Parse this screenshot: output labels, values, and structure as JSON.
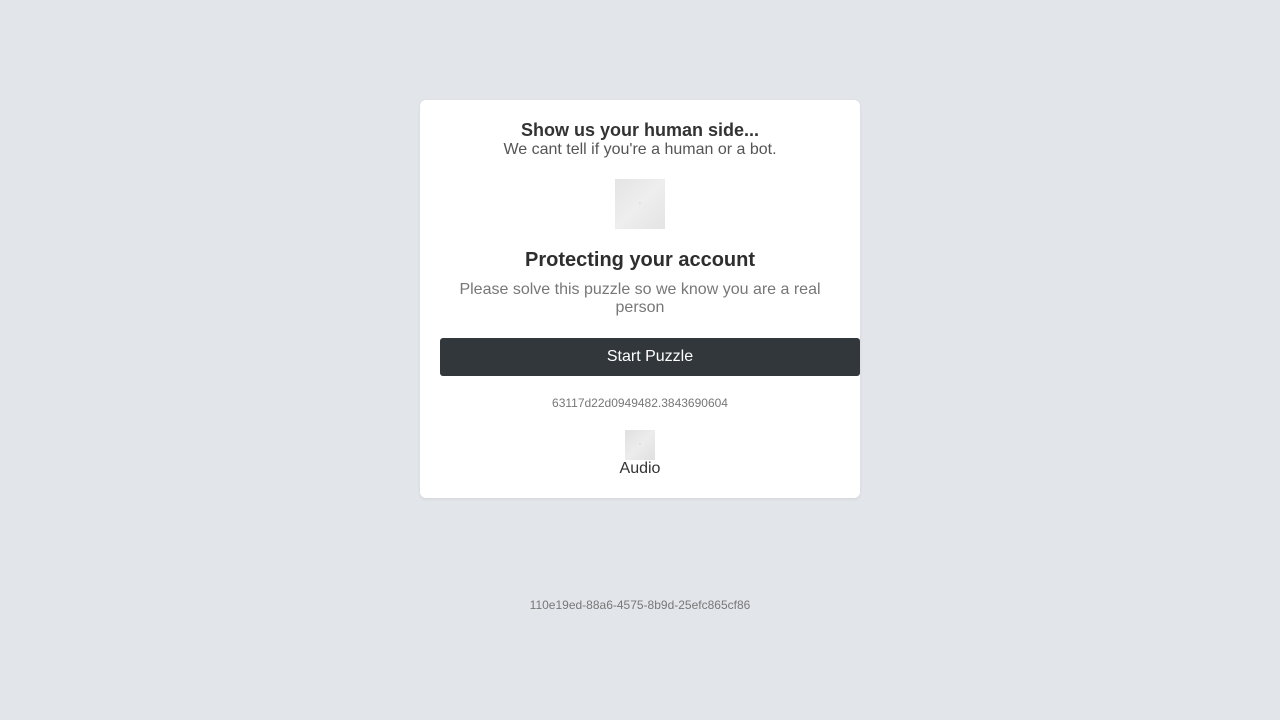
{
  "challenge": {
    "title": "Show us your human side...",
    "subtitle": "We cant tell if you're a human or a bot.",
    "heading": "Protecting your account",
    "description": "Please solve this puzzle so we know you are a real person",
    "start_button_label": "Start Puzzle",
    "session_id": "63117d22d0949482.3843690604",
    "audio_label": "Audio",
    "challenge_image_icon": "broken-image-icon",
    "audio_image_icon": "broken-image-icon"
  },
  "footer": {
    "request_id": "110e19ed-88a6-4575-8b9d-25efc865cf86"
  },
  "colors": {
    "background": "#e2e5e9",
    "card": "#ffffff",
    "button": "#32373c",
    "button_text": "#ffffff"
  }
}
